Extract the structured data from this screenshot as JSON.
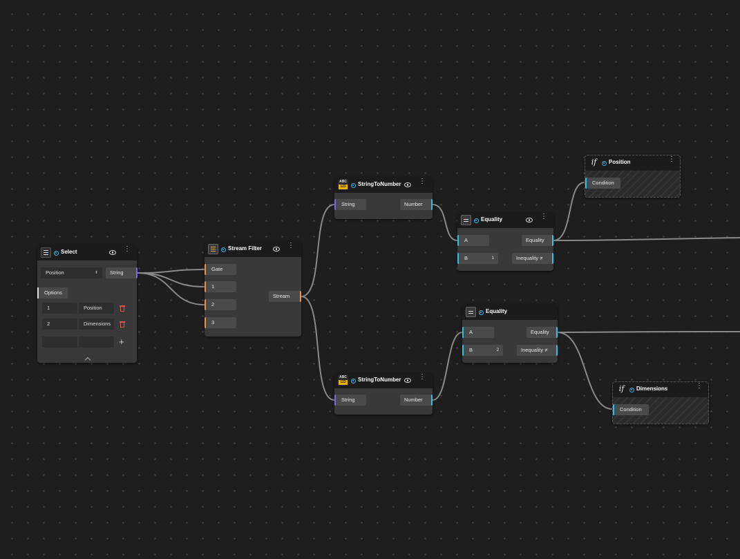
{
  "nodes": {
    "select": {
      "title": "Select",
      "selected_value": "Position",
      "output": "String",
      "options_tab": "Options",
      "options": [
        {
          "index": "1",
          "label": "Position"
        },
        {
          "index": "2",
          "label": "Dimensions"
        }
      ]
    },
    "stream_filter": {
      "title": "Stream Filter",
      "inputs": [
        "Gate",
        "1",
        "2",
        "3"
      ],
      "output": "Stream"
    },
    "string_to_number_top": {
      "title": "StringToNumber",
      "input": "String",
      "output": "Number"
    },
    "string_to_number_bottom": {
      "title": "StringToNumber",
      "input": "String",
      "output": "Number"
    },
    "equality_top": {
      "title": "Equality",
      "input_a": "A",
      "input_b": "B",
      "b_value": "1",
      "output_equality": "Equality",
      "output_inequality": "Inequality ≠"
    },
    "equality_bottom": {
      "title": "Equality",
      "input_a": "A",
      "input_b": "B",
      "b_value": "2",
      "output_equality": "Equality",
      "output_inequality": "Inequality ≠"
    },
    "if_position": {
      "title": "Position",
      "input": "Condition"
    },
    "if_dimensions": {
      "title": "Dimensions",
      "input": "Condition"
    }
  },
  "icons": {
    "select": "list-icon",
    "stream_filter": "filter-icon",
    "string_to_number": "abc-123-icon",
    "equality": "equals-icon",
    "if": "if-icon",
    "visibility": "eye-icon",
    "menu": "kebab-icon",
    "delete": "trash-icon",
    "add": "plus-icon",
    "collapse": "chevron-up-icon"
  },
  "colors": {
    "background": "#1e1e1e",
    "node": "#393939",
    "header": "#1b1b1b",
    "port_string": "#7c68e8",
    "port_stream": "#e8963c",
    "port_boolean": "#2fc0e8",
    "accent_dot": "#2fb5e8",
    "delete": "#e05050",
    "wire": "#8a8a8a"
  }
}
